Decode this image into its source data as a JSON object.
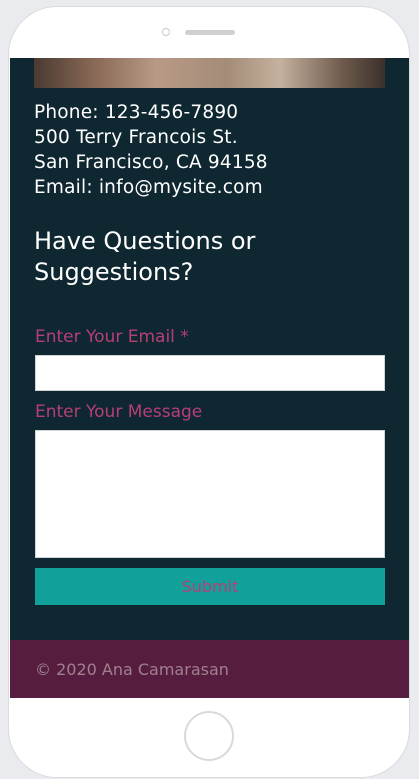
{
  "contact": {
    "phone": "Phone: 123-456-7890",
    "street": "500 Terry Francois St.",
    "city": "San Francisco, CA 94158",
    "email": "Email: info@mysite.com"
  },
  "form": {
    "heading_line1": "Have Questions or",
    "heading_line2": "Suggestions?",
    "email_label": "Enter Your Email *",
    "email_value": "",
    "message_label": "Enter Your Message",
    "message_value": "",
    "submit_label": "Submit"
  },
  "footer": {
    "copyright": "© 2020 Ana Camarasan"
  },
  "colors": {
    "background": "#0f2731",
    "label": "#b73e78",
    "submit_bg": "#12a09a",
    "footer_bg": "#571d3e"
  }
}
